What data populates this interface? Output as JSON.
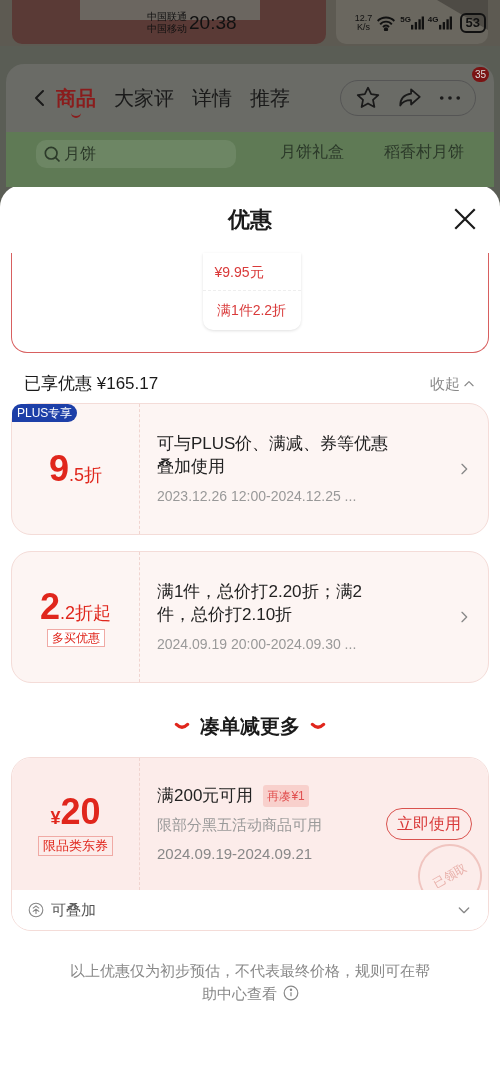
{
  "status_bar": {
    "carriers": [
      "中国联通",
      "中国移动"
    ],
    "time": "20:38",
    "speed_value": "12.7",
    "speed_unit": "K/s",
    "networks": [
      "5G",
      "4G"
    ],
    "battery": "53"
  },
  "nav": {
    "tabs": [
      {
        "label": "商品",
        "selected": true
      },
      {
        "label": "大家评",
        "selected": false
      },
      {
        "label": "详情",
        "selected": false
      },
      {
        "label": "推荐",
        "selected": false
      }
    ],
    "badge": "35"
  },
  "search": {
    "value": "月饼",
    "categories": [
      "月饼礼盒",
      "稻香村月饼"
    ]
  },
  "sheet": {
    "title": "优惠",
    "top_card": {
      "price": "¥9.95元",
      "rule": "满1件2.2折"
    },
    "summary": {
      "label": "已享优惠 ¥165.17",
      "toggle": "收起"
    },
    "offers": [
      {
        "tag": "PLUS专享",
        "big": "9",
        "small": ".5折",
        "description": "可与PLUS价、满减、券等优惠叠加使用",
        "period": "2023.12.26 12:00-2024.12.25 ..."
      },
      {
        "label": "多买优惠",
        "big": "2",
        "small": ".2折起",
        "description": "满1件，总价打2.20折；满2件，总价打2.10折",
        "period": "2024.09.19 20:00-2024.09.30 ..."
      }
    ],
    "section_title": "凑单减更多",
    "coupon": {
      "currency": "¥",
      "amount": "20",
      "type": "限品类东券",
      "condition": "满200元可用",
      "hint": "再凑¥1",
      "scope": "限部分黑五活动商品可用",
      "period": "2024.09.19-2024.09.21",
      "button": "立即使用",
      "stamp": "已领取",
      "stack": "可叠加",
      "expanded": false
    },
    "note": "以上优惠仅为初步预估，不代表最终价格，规则可在帮助中心查看"
  }
}
